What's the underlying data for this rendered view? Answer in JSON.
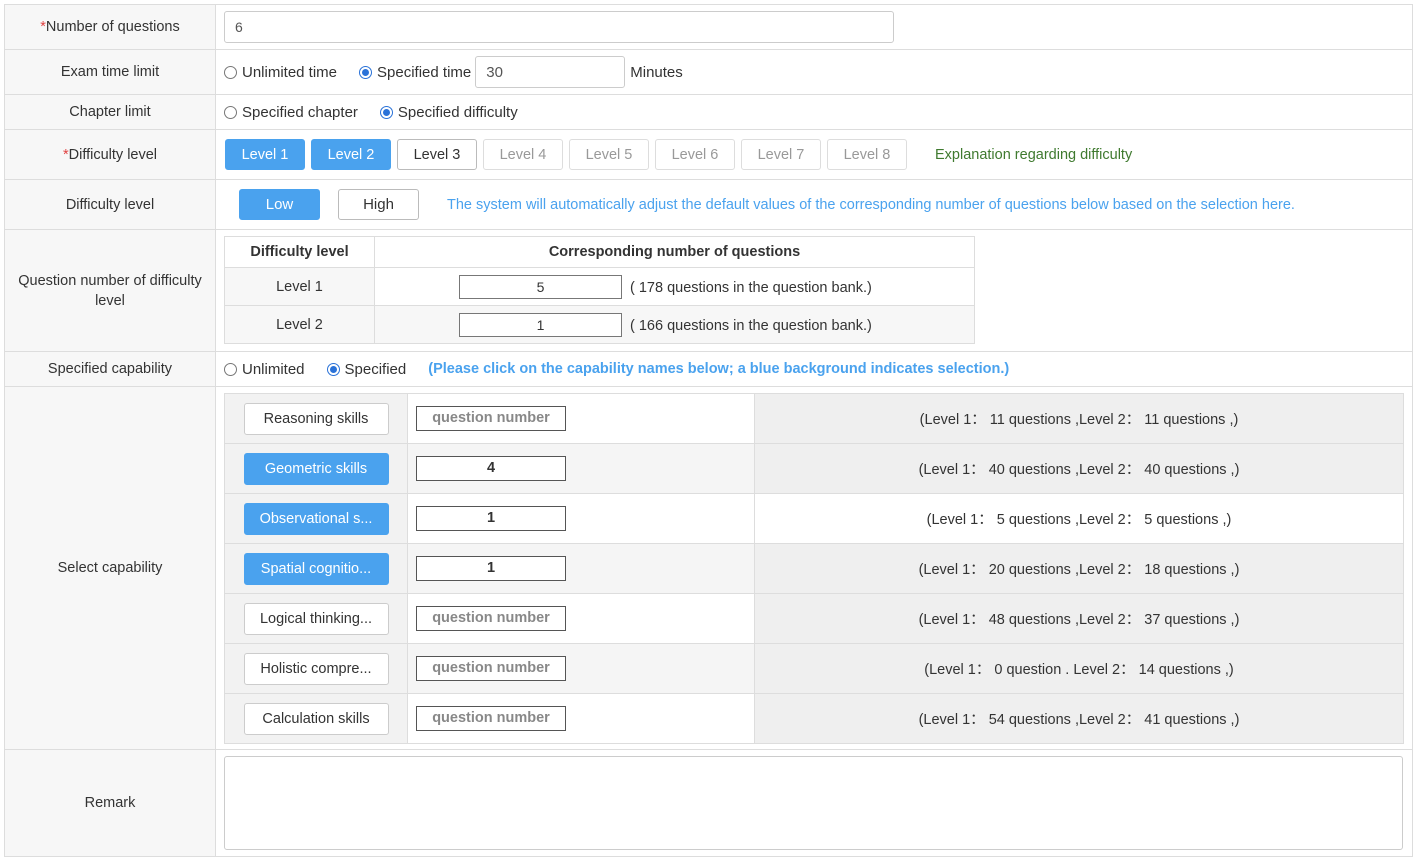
{
  "fields": {
    "num_questions": {
      "label": "Number of questions",
      "required_mark": "*",
      "value": "6"
    },
    "time_limit": {
      "label": "Exam time limit",
      "options": [
        {
          "label": "Unlimited time",
          "selected": false
        },
        {
          "label": "Specified time",
          "selected": true
        }
      ],
      "minutes_value": "30",
      "unit": "Minutes"
    },
    "chapter_limit": {
      "label": "Chapter limit",
      "options": [
        {
          "label": "Specified chapter",
          "selected": false
        },
        {
          "label": "Specified difficulty",
          "selected": true
        }
      ]
    },
    "difficulty_levels": {
      "label": "Difficulty level",
      "required_mark": "*",
      "levels": [
        {
          "label": "Level 1",
          "state": "selected"
        },
        {
          "label": "Level 2",
          "state": "selected"
        },
        {
          "label": "Level 3",
          "state": "enabled"
        },
        {
          "label": "Level 4",
          "state": "disabled"
        },
        {
          "label": "Level 5",
          "state": "disabled"
        },
        {
          "label": "Level 6",
          "state": "disabled"
        },
        {
          "label": "Level 7",
          "state": "disabled"
        },
        {
          "label": "Level 8",
          "state": "disabled"
        }
      ],
      "explanation_link": "Explanation regarding difficulty"
    },
    "difficulty_range": {
      "label": "Difficulty level",
      "low": "Low",
      "high": "High",
      "selected": "low",
      "hint": "The system will automatically adjust the default values of the corresponding number of questions below based on the selection here."
    },
    "question_number_of_level": {
      "label": "Question number of difficulty level",
      "headers": [
        "Difficulty level",
        "Corresponding number of questions"
      ],
      "rows": [
        {
          "level": "Level 1",
          "value": "5",
          "bank": "( 178 questions in the question bank.)"
        },
        {
          "level": "Level 2",
          "value": "1",
          "bank": "( 166 questions in the question bank.)"
        }
      ]
    },
    "specified_capability": {
      "label": "Specified capability",
      "options": [
        {
          "label": "Unlimited",
          "selected": false
        },
        {
          "label": "Specified",
          "selected": true
        }
      ],
      "hint": "(Please click on the capability names below; a blue background indicates selection.)"
    },
    "select_capability": {
      "label": "Select capability",
      "placeholder": "question number",
      "rows": [
        {
          "name": "Reasoning skills",
          "selected": false,
          "value": "",
          "info": "(Level 1： 11 questions ,Level 2： 11 questions ,)"
        },
        {
          "name": "Geometric skills",
          "selected": true,
          "value": "4",
          "info": "(Level 1： 40 questions ,Level 2： 40 questions ,)"
        },
        {
          "name": "Observational s...",
          "selected": true,
          "value": "1",
          "info": "(Level 1： 5 questions ,Level 2： 5 questions ,)"
        },
        {
          "name": "Spatial cognitio...",
          "selected": true,
          "value": "1",
          "info": "(Level 1： 20 questions ,Level 2： 18 questions ,)"
        },
        {
          "name": "Logical thinking...",
          "selected": false,
          "value": "",
          "info": "(Level 1： 48 questions ,Level 2： 37 questions ,)"
        },
        {
          "name": "Holistic compre...",
          "selected": false,
          "value": "",
          "info": "(Level 1： 0 question . Level 2： 14 questions ,)"
        },
        {
          "name": "Calculation skills",
          "selected": false,
          "value": "",
          "info": "(Level 1： 54 questions ,Level 2： 41 questions ,)"
        }
      ]
    },
    "remark": {
      "label": "Remark",
      "value": ""
    }
  },
  "colors": {
    "accent": "#4aa2ee",
    "required": "#e04040",
    "explanation": "#3f7a2f"
  }
}
